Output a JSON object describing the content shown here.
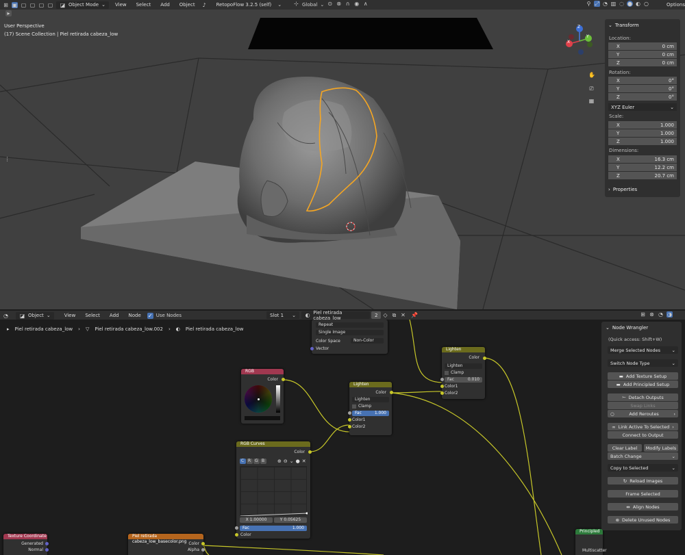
{
  "top_header": {
    "mode": "Object Mode",
    "menus": [
      "View",
      "Select",
      "Add",
      "Object"
    ],
    "addon": "RetopoFlow 3.2.5 (self)",
    "orientation": "Global",
    "options": "Options"
  },
  "viewport": {
    "perspective": "User Perspective",
    "collection": "(17) Scene Collection | Piel retirada cabeza_low"
  },
  "gizmo": {
    "x": "X",
    "y": "Y",
    "z": "Z"
  },
  "npanel": {
    "title": "Transform",
    "location_label": "Location:",
    "location": [
      {
        "axis": "X",
        "value": "0 cm"
      },
      {
        "axis": "Y",
        "value": "0 cm"
      },
      {
        "axis": "Z",
        "value": "0 cm"
      }
    ],
    "rotation_label": "Rotation:",
    "rotation": [
      {
        "axis": "X",
        "value": "0°"
      },
      {
        "axis": "Y",
        "value": "0°"
      },
      {
        "axis": "Z",
        "value": "0°"
      }
    ],
    "rotation_mode": "XYZ Euler",
    "scale_label": "Scale:",
    "scale": [
      {
        "axis": "X",
        "value": "1.000"
      },
      {
        "axis": "Y",
        "value": "1.000"
      },
      {
        "axis": "Z",
        "value": "1.000"
      }
    ],
    "dimensions_label": "Dimensions:",
    "dimensions": [
      {
        "axis": "X",
        "value": "16.3 cm"
      },
      {
        "axis": "Y",
        "value": "12.2 cm"
      },
      {
        "axis": "Z",
        "value": "20.7 cm"
      }
    ],
    "properties": "Properties"
  },
  "node_header": {
    "type": "Object",
    "menus": [
      "View",
      "Select",
      "Add",
      "Node"
    ],
    "use_nodes": "Use Nodes",
    "slot": "Slot 1",
    "material": "Piel retirada cabeza_low",
    "users": "2"
  },
  "breadcrumb": [
    "Piel retirada cabeza_low",
    "Piel retirada cabeza_low.002",
    "Piel retirada cabeza_low"
  ],
  "nodes": {
    "image_top": {
      "repeat": "Repeat",
      "single": "Single Image",
      "colorspace_label": "Color Space",
      "colorspace": "Non-Color",
      "vector": "Vector"
    },
    "rgb": {
      "title": "RGB",
      "out": "Color"
    },
    "lighten1": {
      "title": "Lighten",
      "out": "Color",
      "blend": "Lighten",
      "clamp": "Clamp",
      "fac_label": "Fac",
      "fac": "1.000",
      "c1": "Color1",
      "c2": "Color2"
    },
    "lighten2": {
      "title": "Lighten",
      "out": "Color",
      "blend": "Lighten",
      "clamp": "Clamp",
      "fac_label": "Fac",
      "fac": "0.010",
      "c1": "Color1",
      "c2": "Color2"
    },
    "curves": {
      "title": "RGB Curves",
      "out": "Color",
      "tabs": [
        "C",
        "R",
        "G",
        "B"
      ],
      "x": "X 1.00000",
      "y": "Y 0.05625",
      "fac_label": "Fac",
      "fac": "1.000",
      "in": "Color"
    },
    "texcoord": {
      "title": "Texture Coordinate",
      "generated": "Generated",
      "normal": "Normal"
    },
    "image_bottom": {
      "title": "Piel retirada cabeza_low_basecolor.png",
      "color": "Color",
      "alpha": "Alpha"
    },
    "principled": {
      "title": "Principled",
      "multiscatter": "Multiscatter"
    }
  },
  "node_wrangler": {
    "title": "Node Wrangler",
    "quick": "(Quick access: Shift+W)",
    "merge": "Merge Selected Nodes",
    "switch": "Switch Node Type",
    "add_texture": "Add Texture Setup",
    "add_principled": "Add Principled Setup",
    "detach": "Detach Outputs",
    "swap": "Swap Links",
    "reroutes": "Add Reroutes",
    "link_active": "Link Active To Selected",
    "connect": "Connect to Output",
    "clear_label": "Clear Label",
    "modify_labels": "Modify Labels",
    "batch": "Batch Change",
    "copy": "Copy to Selected",
    "reload": "Reload Images",
    "frame": "Frame Selected",
    "align": "Align Nodes",
    "delete": "Delete Unused Nodes"
  },
  "colors": {
    "accent": "#4772b3",
    "selection": "#f5a623",
    "link": "#c7c729"
  }
}
